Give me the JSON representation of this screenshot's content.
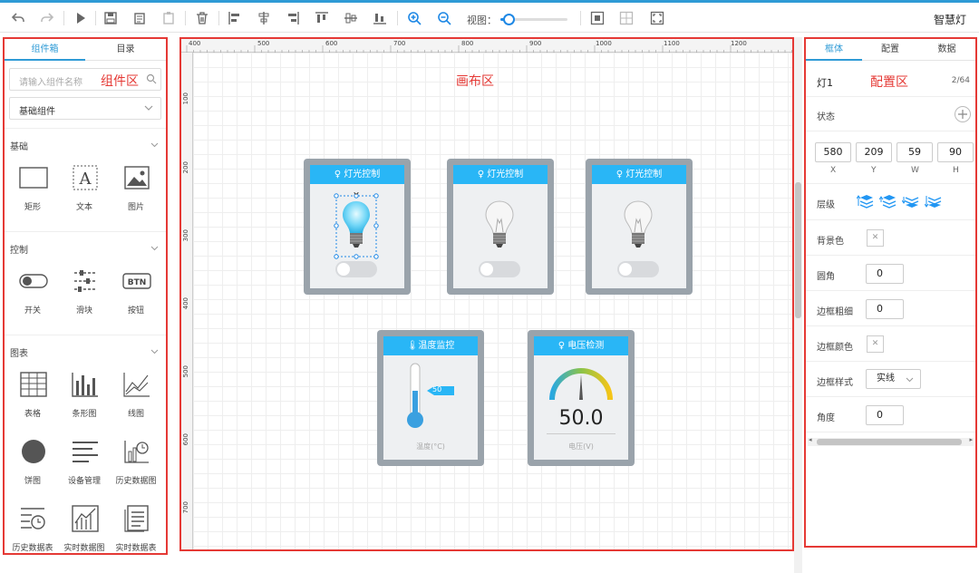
{
  "app": {
    "title": "智慧灯"
  },
  "toolbar": {
    "view_label": "视图：",
    "zoom_percent": 12
  },
  "left_panel": {
    "tabs": [
      {
        "label": "组件箱"
      },
      {
        "label": "目录"
      }
    ],
    "search": {
      "placeholder": "请输入组件名称",
      "area_label": "组件区"
    },
    "category_select": {
      "value": "基础组件"
    },
    "sections": [
      {
        "title": "基础",
        "items": [
          {
            "label": "矩形",
            "icon": "rectangle-icon"
          },
          {
            "label": "文本",
            "icon": "text-icon"
          },
          {
            "label": "图片",
            "icon": "image-icon"
          }
        ]
      },
      {
        "title": "控制",
        "items": [
          {
            "label": "开关",
            "icon": "switch-icon"
          },
          {
            "label": "滑块",
            "icon": "slider-icon"
          },
          {
            "label": "按钮",
            "icon": "button-icon",
            "badge": "BTN"
          }
        ]
      },
      {
        "title": "图表",
        "items": [
          {
            "label": "表格",
            "icon": "table-icon"
          },
          {
            "label": "条形图",
            "icon": "bar-chart-icon"
          },
          {
            "label": "线图",
            "icon": "line-chart-icon"
          },
          {
            "label": "饼图",
            "icon": "pie-chart-icon"
          },
          {
            "label": "设备管理",
            "icon": "device-list-icon"
          },
          {
            "label": "历史数据图",
            "icon": "history-chart-icon"
          },
          {
            "label": "历史数据表",
            "icon": "history-table-icon"
          },
          {
            "label": "实时数据图",
            "icon": "realtime-chart-icon"
          },
          {
            "label": "实时数据表",
            "icon": "realtime-table-icon"
          }
        ]
      }
    ]
  },
  "canvas": {
    "area_label": "画布区",
    "ruler_x": [
      "400",
      "500",
      "600",
      "700",
      "800",
      "900",
      "1000",
      "1100",
      "1200"
    ],
    "ruler_y": [
      "100",
      "200",
      "300",
      "400",
      "500",
      "600",
      "700"
    ],
    "light_cards": [
      {
        "title": "灯光控制",
        "on": true
      },
      {
        "title": "灯光控制",
        "on": false
      },
      {
        "title": "灯光控制",
        "on": false
      }
    ],
    "temperature_card": {
      "title": "温度监控",
      "value": "50",
      "level": 50,
      "caption": "温度(°C)"
    },
    "voltage_card": {
      "title": "电压检测",
      "value": "50.0",
      "caption": "电压(V)"
    }
  },
  "right_panel": {
    "tabs": [
      {
        "label": "框体"
      },
      {
        "label": "配置"
      },
      {
        "label": "数据"
      }
    ],
    "object_name": "灯1",
    "area_label": "配置区",
    "page_counter": "2/64",
    "state_label": "状态",
    "position": {
      "x": "580",
      "y": "209",
      "w": "59",
      "h": "90",
      "x_label": "X",
      "y_label": "Y",
      "w_label": "W",
      "h_label": "H"
    },
    "layer_label": "层级",
    "bg_color_label": "背景色",
    "radius_label": "圆角",
    "radius_value": "0",
    "border_width_label": "边框粗细",
    "border_width_value": "0",
    "border_color_label": "边框颜色",
    "border_style_label": "边框样式",
    "border_style_value": "实线",
    "angle_label": "角度",
    "angle_value": "0"
  }
}
